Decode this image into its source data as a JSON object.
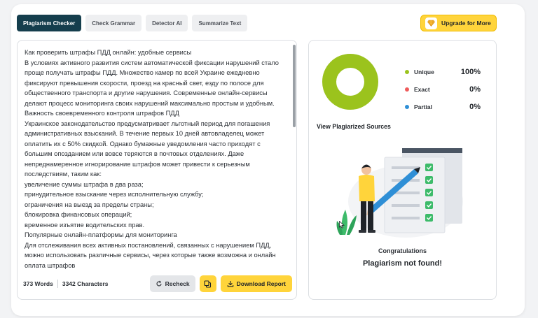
{
  "tabs": [
    {
      "label": "Plagiarism Checker",
      "active": true
    },
    {
      "label": "Check Grammar",
      "active": false
    },
    {
      "label": "Detector AI",
      "active": false
    },
    {
      "label": "Summarize Text",
      "active": false
    }
  ],
  "upgrade": {
    "label": "Upgrade for More",
    "icon": "diamond-icon"
  },
  "editor": {
    "lines": [
      "Как проверить штрафы ПДД онлайн: удобные сервисы",
      "В условиях активного развития систем автоматической фиксации нарушений стало проще получать штрафы ПДД. Множество камер по всей Украине ежедневно фиксируют превышения скорости, проезд на красный свет, езду по полосе для общественного транспорта и другие нарушения. Современные онлайн-сервисы делают процесс мониторинга своих нарушений максимально простым и удобным.",
      "Важность своевременного контроля штрафов ПДД",
      "Украинское законодательство предусматривает льготный период для погашения административных взысканий. В течение первых 10 дней автовладелец может оплатить их с 50% скидкой. Однако бумажные уведомления часто приходят с большим опозданием или вовсе теряются в почтовых отделениях. Даже непреднамеренное игнорирование штрафов может привести к серьезным последствиям, таким как:",
      "увеличение суммы штрафа в два раза;",
      "принудительное взыскание через исполнительную службу;",
      "ограничения на выезд за пределы страны;",
      "блокировка финансовых операций;",
      "временное изъятие водительских прав.",
      "Популярные онлайн-платформы для мониторинга",
      "Для отслеживания всех активных постановлений, связанных с нарушением ПДД, можно использовать различные сервисы, через которые также возможна и онлайн оплата штрафов"
    ],
    "words": "373 Words",
    "characters": "3342 Characters",
    "recheck_label": "Recheck",
    "download_label": "Download Report"
  },
  "results": {
    "legend": [
      {
        "label": "Unique",
        "value": "100%",
        "color": "#9bc31d"
      },
      {
        "label": "Exact",
        "value": "0%",
        "color": "#ef5b5b"
      },
      {
        "label": "Partial",
        "value": "0%",
        "color": "#2f8fd6"
      }
    ],
    "unique_fraction": 1.0,
    "view_sources_label": "View Plagiarized Sources",
    "congrats": "Congratulations",
    "not_found": "Plagiarism not found!"
  },
  "colors": {
    "tab_active_bg": "#153e4d",
    "accent_yellow": "#ffd43b",
    "unique_green": "#9bc31d"
  }
}
